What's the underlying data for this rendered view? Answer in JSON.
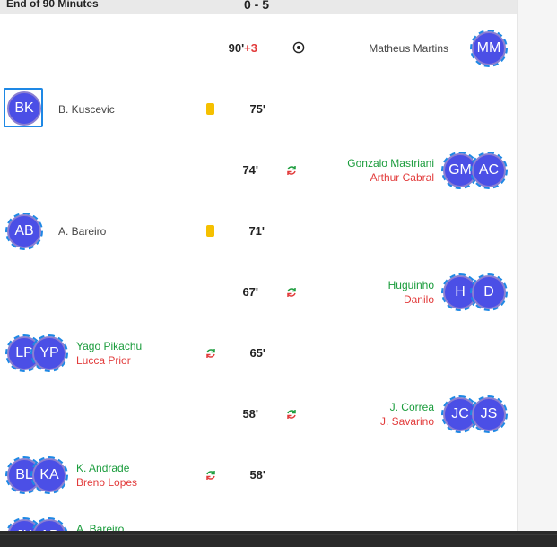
{
  "header": {
    "title": "End of 90 Minutes",
    "score": "0 - 5"
  },
  "events": [
    {
      "minute": "90'",
      "added": "+3",
      "type": "goal",
      "side": "right",
      "player": "Matheus Martins",
      "initials": "MM"
    },
    {
      "minute": "75'",
      "type": "yellow-card",
      "side": "left",
      "player": "B. Kuscevic",
      "initials": "BK"
    },
    {
      "minute": "74'",
      "type": "substitution",
      "side": "right",
      "player_in": "Gonzalo Mastriani",
      "player_out": "Arthur Cabral",
      "initials_in": "GM",
      "initials_out": "AC"
    },
    {
      "minute": "71'",
      "type": "yellow-card",
      "side": "left",
      "player": "A. Bareiro",
      "initials": "AB"
    },
    {
      "minute": "67'",
      "type": "substitution",
      "side": "right",
      "player_in": "Huguinho",
      "player_out": "Danilo",
      "initials_in": "H",
      "initials_out": "D"
    },
    {
      "minute": "65'",
      "type": "substitution",
      "side": "left",
      "player_in": "Yago Pikachu",
      "player_out": "Lucca Prior",
      "initials_in": "LP",
      "initials_out": "YP"
    },
    {
      "minute": "58'",
      "type": "substitution",
      "side": "right",
      "player_in": "J. Correa",
      "player_out": "J. Savarino",
      "initials_in": "JC",
      "initials_out": "JS"
    },
    {
      "minute": "58'",
      "type": "substitution",
      "side": "left",
      "player_in": "K. Andrade",
      "player_out": "Breno Lopes",
      "initials_in": "BL",
      "initials_out": "KA"
    },
    {
      "type": "substitution",
      "side": "left",
      "player_in": "A. Bareiro",
      "initials_in": "JK",
      "initials_out": "AB"
    }
  ],
  "colors": {
    "avatar": "#4b4fe6",
    "in": "#1a9c3c",
    "out": "#e23b3b",
    "card": "#f5c000",
    "selection": "#1e88e5"
  },
  "icons": {
    "goal": "soccer-ball-icon",
    "card": "yellow-card-icon",
    "sub": "substitution-arrows-icon"
  }
}
